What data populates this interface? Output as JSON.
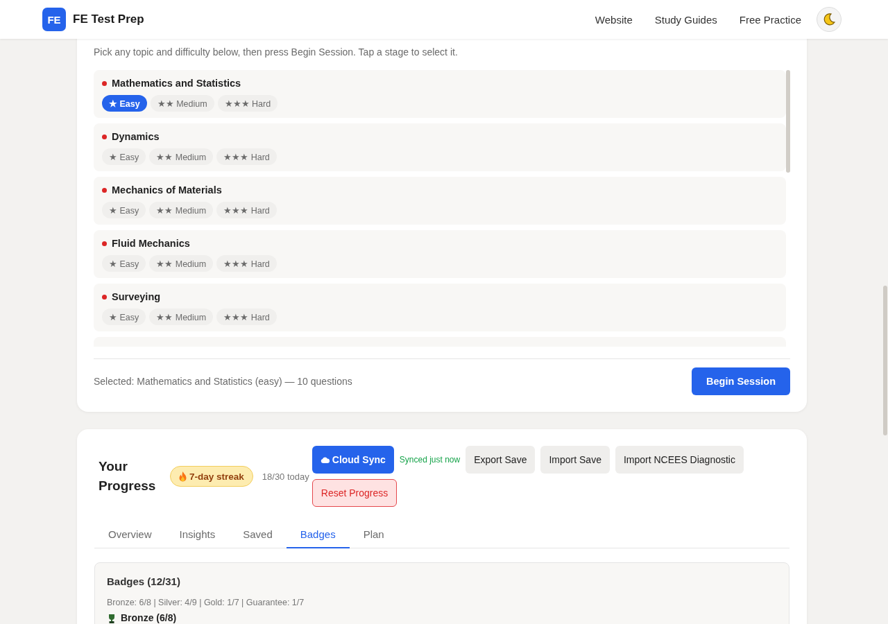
{
  "header": {
    "logo": "FE",
    "title": "FE Test Prep",
    "nav": [
      "Website",
      "Study Guides",
      "Free Practice"
    ]
  },
  "session_card": {
    "instructions": "Pick any topic and difficulty below, then press Begin Session. Tap a stage to select it.",
    "topics": [
      {
        "name": "Mathematics and Statistics",
        "difficulties": [
          {
            "label": "★ Easy",
            "selected": true
          },
          {
            "label": "★★ Medium",
            "selected": false
          },
          {
            "label": "★★★ Hard",
            "selected": false
          }
        ]
      },
      {
        "name": "Dynamics",
        "difficulties": [
          {
            "label": "★ Easy",
            "selected": false
          },
          {
            "label": "★★ Medium",
            "selected": false
          },
          {
            "label": "★★★ Hard",
            "selected": false
          }
        ]
      },
      {
        "name": "Mechanics of Materials",
        "difficulties": [
          {
            "label": "★ Easy",
            "selected": false
          },
          {
            "label": "★★ Medium",
            "selected": false
          },
          {
            "label": "★★★ Hard",
            "selected": false
          }
        ]
      },
      {
        "name": "Fluid Mechanics",
        "difficulties": [
          {
            "label": "★ Easy",
            "selected": false
          },
          {
            "label": "★★ Medium",
            "selected": false
          },
          {
            "label": "★★★ Hard",
            "selected": false
          }
        ]
      },
      {
        "name": "Surveying",
        "difficulties": [
          {
            "label": "★ Easy",
            "selected": false
          },
          {
            "label": "★★ Medium",
            "selected": false
          },
          {
            "label": "★★★ Hard",
            "selected": false
          }
        ]
      }
    ],
    "more_topics_below": true,
    "selection_summary": "Selected: Mathematics and Statistics (easy) — 10 questions",
    "begin_button": "Begin Session"
  },
  "progress_card": {
    "title": "Your Progress",
    "streak": "7-day streak",
    "today": "18/30 today",
    "actions": [
      {
        "kind": "sync",
        "label": "Cloud Sync"
      },
      {
        "kind": "status",
        "label": "Synced just now"
      },
      {
        "kind": "secondary",
        "label": "Export Save"
      },
      {
        "kind": "secondary",
        "label": "Import Save"
      },
      {
        "kind": "secondary",
        "label": "Import NCEES Diagnostic"
      },
      {
        "kind": "danger",
        "label": "Reset Progress"
      }
    ],
    "tabs": [
      {
        "label": "Overview",
        "selected": false
      },
      {
        "label": "Insights",
        "selected": false
      },
      {
        "label": "Saved",
        "selected": false
      },
      {
        "label": "Badges",
        "selected": true
      },
      {
        "label": "Plan",
        "selected": false
      }
    ],
    "badges_panel": {
      "title": "Badges (12/31)",
      "summary": "Bronze: 6/8 | Silver: 4/9 | Gold: 1/7 | Guarantee: 1/7",
      "groups": [
        {
          "title": "Bronze (6/8)"
        }
      ]
    }
  }
}
